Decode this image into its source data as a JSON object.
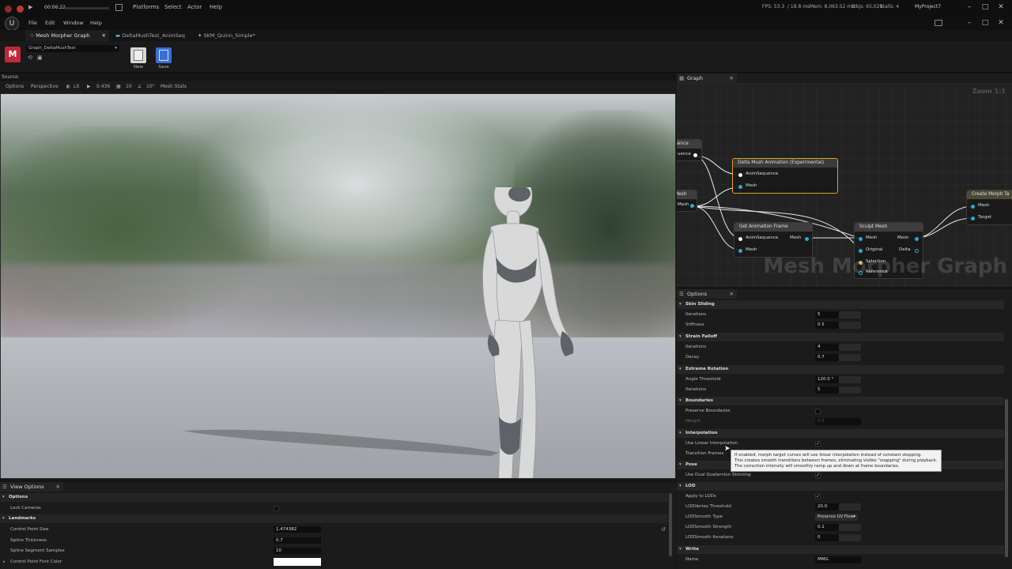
{
  "titlebar": {
    "timer": "00:06:22",
    "menus": [
      "Platforms",
      "Select",
      "Actor",
      "Help"
    ],
    "stats": {
      "fps": "FPS: 53.3",
      "ms": "/ 18.8 ms",
      "mem": "Mem: 8,063.52 mb",
      "objs": "Objs: 65,029",
      "stalls": "Stalls: 4"
    },
    "project": "MyProject7"
  },
  "menubar": {
    "items": [
      "File",
      "Edit",
      "Window",
      "Help"
    ]
  },
  "tabs": [
    {
      "label": "Mesh Morpher Graph",
      "active": true
    },
    {
      "label": "DeltaMushTest_AnimSeq",
      "active": false
    },
    {
      "label": "SKM_Quinn_Simple*",
      "active": false
    }
  ],
  "toolbar": {
    "graph_name": "Graph_DeltaMushTest",
    "new_label": "New",
    "save_label": "Save"
  },
  "viewport": {
    "source_label": "Source:",
    "buttons": {
      "options": "Options",
      "perspective": "Perspective",
      "lit": "Lit",
      "speed": "0.436",
      "grid": "10",
      "angle": "10°",
      "mesh_stats": "Mesh Stats"
    }
  },
  "graph": {
    "tab_label": "Graph",
    "zoom": "Zoom 1:1",
    "watermark": "Mesh Morpher Graph",
    "nodes": {
      "seq_partial_title": "uence",
      "seq_partial_pin": "uence",
      "mesh_partial_title": "Mesh",
      "mesh_partial_pin": "Mesh",
      "delta_mush": {
        "title": "Delta Mush Animation (Experimental)",
        "pins": [
          "AnimSequence",
          "Mesh"
        ]
      },
      "get_anim_frame": {
        "title": "Get Animation Frame",
        "pins": [
          "AnimSequence",
          "Mesh"
        ],
        "out": "Mesh"
      },
      "sculpt_mesh": {
        "title": "Sculpt Mesh",
        "pins": [
          "Mesh",
          "Original",
          "Selection",
          "Reference"
        ],
        "outs": [
          "Mesh",
          "Delta"
        ]
      },
      "create_morph": {
        "title": "Create Morph Ta",
        "pins": [
          "Mesh",
          "Target"
        ]
      }
    }
  },
  "options": {
    "tab_label": "Options",
    "sections": {
      "skin_sliding": {
        "title": "Skin Sliding",
        "iterations_label": "Iterations",
        "iterations": "5",
        "stiffness_label": "Stiffness",
        "stiffness": "0.5"
      },
      "strain_falloff": {
        "title": "Strain Falloff",
        "iterations_label": "Iterations",
        "iterations": "4",
        "decay_label": "Decay",
        "decay": "0.7"
      },
      "extreme_rotation": {
        "title": "Extreme Rotation",
        "angle_label": "Angle Threshold",
        "angle": "120.0 °",
        "iterations_label": "Iterations",
        "iterations": "5"
      },
      "boundaries": {
        "title": "Boundaries",
        "preserve_label": "Preserve Boundaries",
        "weight_label": "Weight",
        "weight": "0.5"
      },
      "interpolation": {
        "title": "Interpolation",
        "linear_label": "Use Linear Interpolation",
        "transition_label": "Transition Frames"
      },
      "pose": {
        "title": "Pose",
        "dual_quat_label": "Use Dual Quaternion Skinning"
      },
      "lod": {
        "title": "LOD",
        "apply_label": "Apply to LODs",
        "vertex_label": "LODVertex Threshold",
        "vertex": "20.0",
        "smooth_type_label": "LODSmooth Type",
        "smooth_type": "Preserve UV Flow",
        "smooth_strength_label": "LODSmooth Strength",
        "smooth_strength": "0.1",
        "smooth_iter_label": "LODSmooth Iterations",
        "smooth_iter": "0"
      },
      "write": {
        "title": "Write",
        "name_label": "Name",
        "name": "MMG"
      }
    },
    "tooltip": [
      "If enabled, morph target curves will use linear interpolation instead of constant stepping.",
      "This creates smooth transitions between frames, eliminating visible \"snapping\" during playback.",
      "The correction intensity will smoothly ramp up and down at frame boundaries."
    ]
  },
  "view_options": {
    "tab_label": "View Options",
    "options_section": "Options",
    "lock_cameras_label": "Lock Cameras",
    "landmarks_section": "Landmarks",
    "control_point_size_label": "Control Point Size",
    "control_point_size": "1.474382",
    "spline_thickness_label": "Spline Thickness",
    "spline_thickness": "0.7",
    "spline_segment_label": "Spline Segment Samples",
    "spline_segment": "10",
    "control_point_font_label": "Control Point Font Color"
  },
  "colors": {
    "accent_blue": "#2aa8d8",
    "node_highlight": "#e0a020",
    "record_red": "#c0392b"
  }
}
